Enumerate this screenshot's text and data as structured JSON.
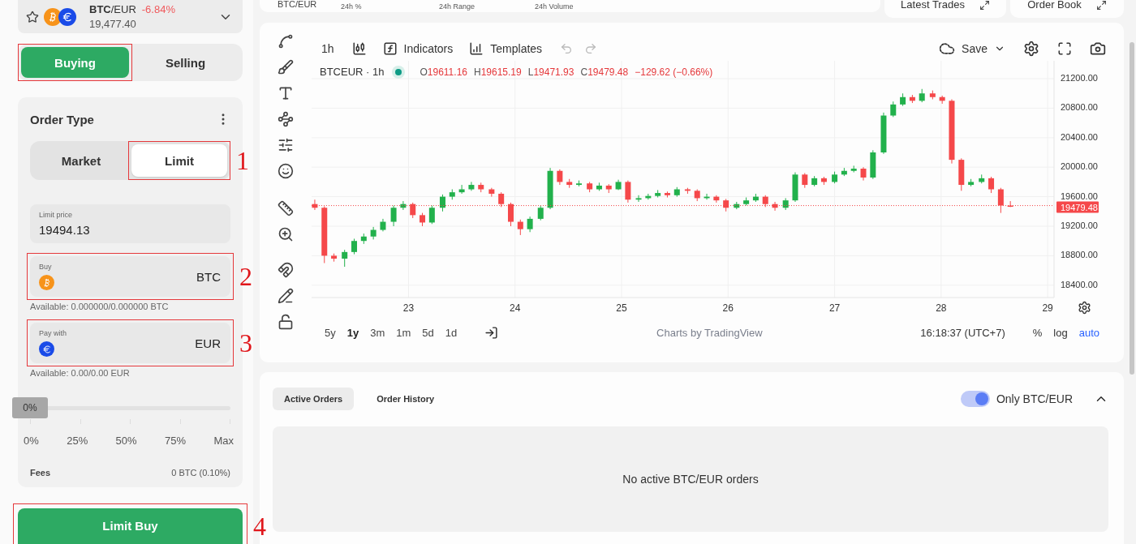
{
  "market": {
    "base": "BTC",
    "quote": "/EUR",
    "change": "-6.84%",
    "price": "19,477.40"
  },
  "side_tabs": [
    {
      "label": "Buying",
      "selected": true,
      "highlighted": true
    },
    {
      "label": "Selling",
      "selected": false,
      "highlighted": false
    }
  ],
  "order_type": {
    "title": "Order Type",
    "tabs": [
      {
        "label": "Market",
        "selected": false,
        "highlighted": false
      },
      {
        "label": "Limit",
        "selected": true,
        "highlighted": true,
        "callout": "1"
      }
    ]
  },
  "limit_price": {
    "label": "Limit price",
    "value": "19494.13"
  },
  "buy_field": {
    "label": "Buy",
    "currency": "BTC",
    "available": "Available: 0.000000/0.000000 BTC",
    "highlighted": true,
    "callout": "2"
  },
  "pay_field": {
    "label": "Pay with",
    "currency": "EUR",
    "available": "Available: 0.00/0.00 EUR",
    "highlighted": true,
    "callout": "3"
  },
  "amount_slider": {
    "level": 0,
    "reading": "0%",
    "marks": [
      "0%",
      "25%",
      "50%",
      "75%",
      "Max"
    ]
  },
  "fees": {
    "label": "Fees",
    "value": "0 BTC (0.10%)"
  },
  "submit": {
    "label": "Limit Buy",
    "highlighted": true,
    "callout": "4"
  },
  "ticker": {
    "pair": "BTC/EUR",
    "stats": [
      "24h %",
      "24h Range",
      "24h Volume"
    ]
  },
  "panels": [
    "Latest Trades",
    "Order Book"
  ],
  "chart": {
    "interval": "1h",
    "indicators": "Indicators",
    "templates": "Templates",
    "save": "Save",
    "symbol": "BTCEUR · 1h",
    "ohlc": [
      {
        "key": "O",
        "value": "19611.16"
      },
      {
        "key": "H",
        "value": "19615.19"
      },
      {
        "key": "L",
        "value": "19471.93"
      },
      {
        "key": "C",
        "value": "19479.48"
      }
    ],
    "change": "−129.62 (−0.66%)",
    "chart_data": {
      "type": "candlestick",
      "x": [
        22.12,
        22.21,
        22.3,
        22.4,
        22.49,
        22.58,
        22.67,
        22.76,
        22.86,
        22.95,
        23.04,
        23.13,
        23.22,
        23.32,
        23.41,
        23.5,
        23.59,
        23.68,
        23.78,
        23.87,
        23.96,
        24.05,
        24.14,
        24.24,
        24.33,
        24.42,
        24.51,
        24.6,
        24.7,
        24.79,
        24.88,
        24.97,
        25.06,
        25.16,
        25.25,
        25.34,
        25.43,
        25.52,
        25.62,
        25.71,
        25.8,
        25.89,
        25.98,
        26.08,
        26.17,
        26.26,
        26.35,
        26.44,
        26.54,
        26.63,
        26.72,
        26.81,
        26.9,
        27.0,
        27.09,
        27.18,
        27.27,
        27.36,
        27.46,
        27.55,
        27.64,
        27.73,
        27.82,
        27.92,
        28.01,
        28.1,
        28.19,
        28.28,
        28.38,
        28.47,
        28.56,
        28.65
      ],
      "xlim": [
        22.09,
        29.06
      ],
      "ylim": [
        18233,
        21442
      ],
      "grid": true,
      "ref_lines": [
        {
          "axis": "y",
          "value": 19479.48,
          "label": "19479.48",
          "color": "#f5484a"
        }
      ],
      "ohlc": [
        [
          19500,
          19560,
          19420,
          19450
        ],
        [
          19450,
          19470,
          18700,
          18800
        ],
        [
          18800,
          18830,
          18720,
          18760
        ],
        [
          18760,
          18880,
          18650,
          18850
        ],
        [
          18850,
          19030,
          18820,
          19000
        ],
        [
          19000,
          19100,
          18960,
          19060
        ],
        [
          19060,
          19190,
          19020,
          19150
        ],
        [
          19150,
          19300,
          19130,
          19260
        ],
        [
          19260,
          19480,
          19200,
          19450
        ],
        [
          19450,
          19540,
          19420,
          19500
        ],
        [
          19500,
          19520,
          19310,
          19350
        ],
        [
          19350,
          19380,
          19200,
          19250
        ],
        [
          19250,
          19480,
          19230,
          19450
        ],
        [
          19450,
          19630,
          19400,
          19600
        ],
        [
          19600,
          19700,
          19560,
          19660
        ],
        [
          19660,
          19760,
          19640,
          19700
        ],
        [
          19700,
          19800,
          19680,
          19760
        ],
        [
          19760,
          19790,
          19660,
          19700
        ],
        [
          19700,
          19720,
          19600,
          19640
        ],
        [
          19640,
          19660,
          19460,
          19500
        ],
        [
          19500,
          19520,
          19200,
          19260
        ],
        [
          19260,
          19290,
          19080,
          19160
        ],
        [
          19160,
          19330,
          19120,
          19300
        ],
        [
          19300,
          19480,
          19280,
          19450
        ],
        [
          19450,
          19990,
          19430,
          19950
        ],
        [
          19950,
          19970,
          19760,
          19800
        ],
        [
          19800,
          19840,
          19720,
          19760
        ],
        [
          19760,
          19820,
          19740,
          19780
        ],
        [
          19780,
          19800,
          19660,
          19700
        ],
        [
          19700,
          19790,
          19680,
          19750
        ],
        [
          19750,
          19770,
          19650,
          19700
        ],
        [
          19700,
          19830,
          19690,
          19800
        ],
        [
          19800,
          19820,
          19520,
          19560
        ],
        [
          19560,
          19620,
          19530,
          19580
        ],
        [
          19580,
          19640,
          19560,
          19610
        ],
        [
          19610,
          19690,
          19590,
          19650
        ],
        [
          19650,
          19670,
          19590,
          19620
        ],
        [
          19620,
          19730,
          19600,
          19700
        ],
        [
          19700,
          19720,
          19640,
          19680
        ],
        [
          19680,
          19700,
          19540,
          19580
        ],
        [
          19580,
          19640,
          19560,
          19600
        ],
        [
          19600,
          19620,
          19520,
          19550
        ],
        [
          19550,
          19570,
          19400,
          19450
        ],
        [
          19450,
          19530,
          19430,
          19500
        ],
        [
          19500,
          19590,
          19480,
          19550
        ],
        [
          19550,
          19640,
          19530,
          19600
        ],
        [
          19600,
          19620,
          19460,
          19500
        ],
        [
          19500,
          19530,
          19410,
          19450
        ],
        [
          19450,
          19580,
          19420,
          19550
        ],
        [
          19550,
          19930,
          19530,
          19900
        ],
        [
          19900,
          19920,
          19720,
          19760
        ],
        [
          19760,
          19880,
          19740,
          19850
        ],
        [
          19850,
          19870,
          19760,
          19800
        ],
        [
          19800,
          19940,
          19780,
          19900
        ],
        [
          19900,
          19990,
          19880,
          19950
        ],
        [
          19950,
          20020,
          19930,
          19980
        ],
        [
          19980,
          20000,
          19820,
          19860
        ],
        [
          19860,
          20230,
          19840,
          20200
        ],
        [
          20200,
          20740,
          20180,
          20700
        ],
        [
          20700,
          20890,
          20680,
          20850
        ],
        [
          20850,
          21000,
          20830,
          20950
        ],
        [
          20950,
          20980,
          20870,
          20900
        ],
        [
          20900,
          21060,
          20880,
          21000
        ],
        [
          21000,
          21040,
          20920,
          20950
        ],
        [
          20950,
          20970,
          20860,
          20900
        ],
        [
          20900,
          20920,
          20050,
          20100
        ],
        [
          20100,
          20120,
          19680,
          19760
        ],
        [
          19760,
          19840,
          19740,
          19800
        ],
        [
          19800,
          19900,
          19780,
          19850
        ],
        [
          19850,
          19870,
          19650,
          19700
        ],
        [
          19700,
          19720,
          19380,
          19480
        ],
        [
          19480,
          19540,
          19460,
          19479.48
        ]
      ],
      "xticks": [
        {
          "value": 23,
          "label": "23"
        },
        {
          "value": 24,
          "label": "24"
        },
        {
          "value": 25,
          "label": "25"
        },
        {
          "value": 26,
          "label": "26"
        },
        {
          "value": 27,
          "label": "27"
        },
        {
          "value": 28,
          "label": "28"
        },
        {
          "value": 29,
          "label": "29"
        }
      ],
      "yticks": [
        {
          "value": 21200,
          "label": "21200.00"
        },
        {
          "value": 20800,
          "label": "20800.00"
        },
        {
          "value": 20400,
          "label": "20400.00"
        },
        {
          "value": 20000,
          "label": "20000.00"
        },
        {
          "value": 19600,
          "label": "19600.00"
        },
        {
          "value": 19200,
          "label": "19200.00"
        },
        {
          "value": 18800,
          "label": "18800.00"
        },
        {
          "value": 18400,
          "label": "18400.00"
        }
      ]
    },
    "ranges": [
      {
        "label": "5y",
        "selected": false
      },
      {
        "label": "1y",
        "selected": true
      },
      {
        "label": "3m",
        "selected": false
      },
      {
        "label": "1m",
        "selected": false
      },
      {
        "label": "5d",
        "selected": false
      },
      {
        "label": "1d",
        "selected": false
      }
    ],
    "credit": "Charts by TradingView",
    "time": "16:18:37 (UTC+7)",
    "scale_options": [
      {
        "label": "%",
        "selected": false
      },
      {
        "label": "log",
        "selected": false
      },
      {
        "label": "auto",
        "selected": true
      }
    ]
  },
  "orders": {
    "tabs": [
      {
        "label": "Active Orders",
        "selected": true
      },
      {
        "label": "Order History",
        "selected": false
      }
    ],
    "filter": {
      "label": "Only BTC/EUR",
      "on": true
    },
    "empty": "No active BTC/EUR orders"
  }
}
